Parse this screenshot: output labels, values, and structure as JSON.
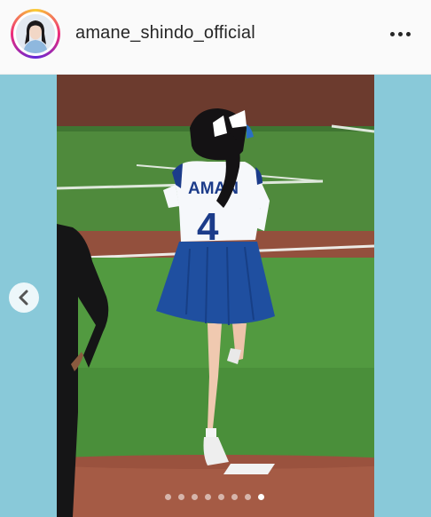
{
  "header": {
    "username": "amane_shindo_official",
    "more_icon": "more-horizontal-icon",
    "avatar_ring_colors": [
      "#f9ce34",
      "#ee2a7b",
      "#6228d7"
    ]
  },
  "post": {
    "jersey_name": "AMAN",
    "jersey_number": "4",
    "background_color": "#89c9d9",
    "prev_icon": "chevron-left-icon"
  },
  "carousel": {
    "slide_count": 8,
    "current_slide": 8
  }
}
